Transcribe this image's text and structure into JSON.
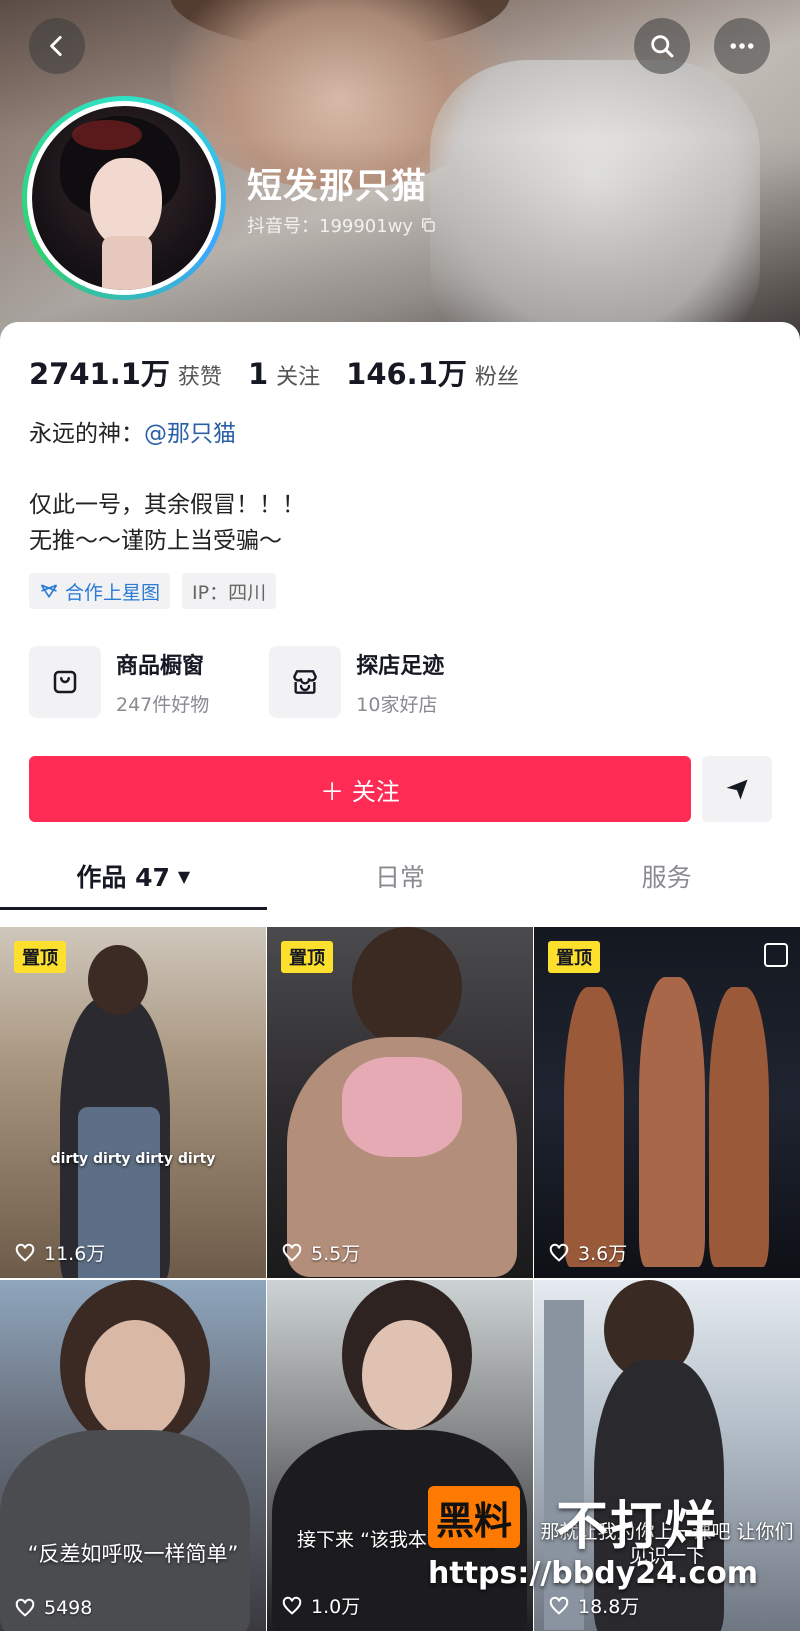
{
  "header": {
    "name": "短发那只猫",
    "douyin_id": "抖音号：199901wy"
  },
  "stats": [
    {
      "num": "2741.1万",
      "label": "获赞"
    },
    {
      "num": "1",
      "label": "关注"
    },
    {
      "num": "146.1万",
      "label": "粉丝"
    }
  ],
  "bio": {
    "line1_prefix": "永远的神：",
    "line1_mention": "@那只猫",
    "line2": "仅此一号，其余假冒！！！",
    "line3": "无推～～谨防上当受骗～"
  },
  "tags": {
    "coop": "合作上星图",
    "ip": "IP：四川"
  },
  "shortcuts": [
    {
      "title": "商品橱窗",
      "sub": "247件好物",
      "icon": "shopping-bag-icon"
    },
    {
      "title": "探店足迹",
      "sub": "10家好店",
      "icon": "store-icon"
    }
  ],
  "follow_label": "＋ 关注",
  "tabs": [
    {
      "label": "作品 47",
      "active": true
    },
    {
      "label": "日常",
      "active": false
    },
    {
      "label": "服务",
      "active": false
    }
  ],
  "pin_label": "置顶",
  "videos": [
    {
      "likes": "11.6万",
      "caption": "dirty dirty dirty dirty",
      "pinned": true
    },
    {
      "likes": "5.5万",
      "caption": "",
      "pinned": true
    },
    {
      "likes": "3.6万",
      "caption": "",
      "pinned": true
    },
    {
      "likes": "5498",
      "caption": "“反差如呼吸一样简单”",
      "pinned": false
    },
    {
      "likes": "1.0万",
      "caption": "接下来 “该我本色出演了",
      "pinned": false
    },
    {
      "likes": "18.8万",
      "caption": "那就让我为你上一课吧 让你们见识一下",
      "pinned": false
    }
  ],
  "watermark": {
    "logo": "黑料",
    "text": "不打烊",
    "url": "https://bbdy24.com"
  },
  "colors": {
    "accent": "#fe2c55",
    "mention": "#2b5fa6",
    "pin_badge": "#fde02e",
    "coop_tag": "#2b7bd6"
  }
}
